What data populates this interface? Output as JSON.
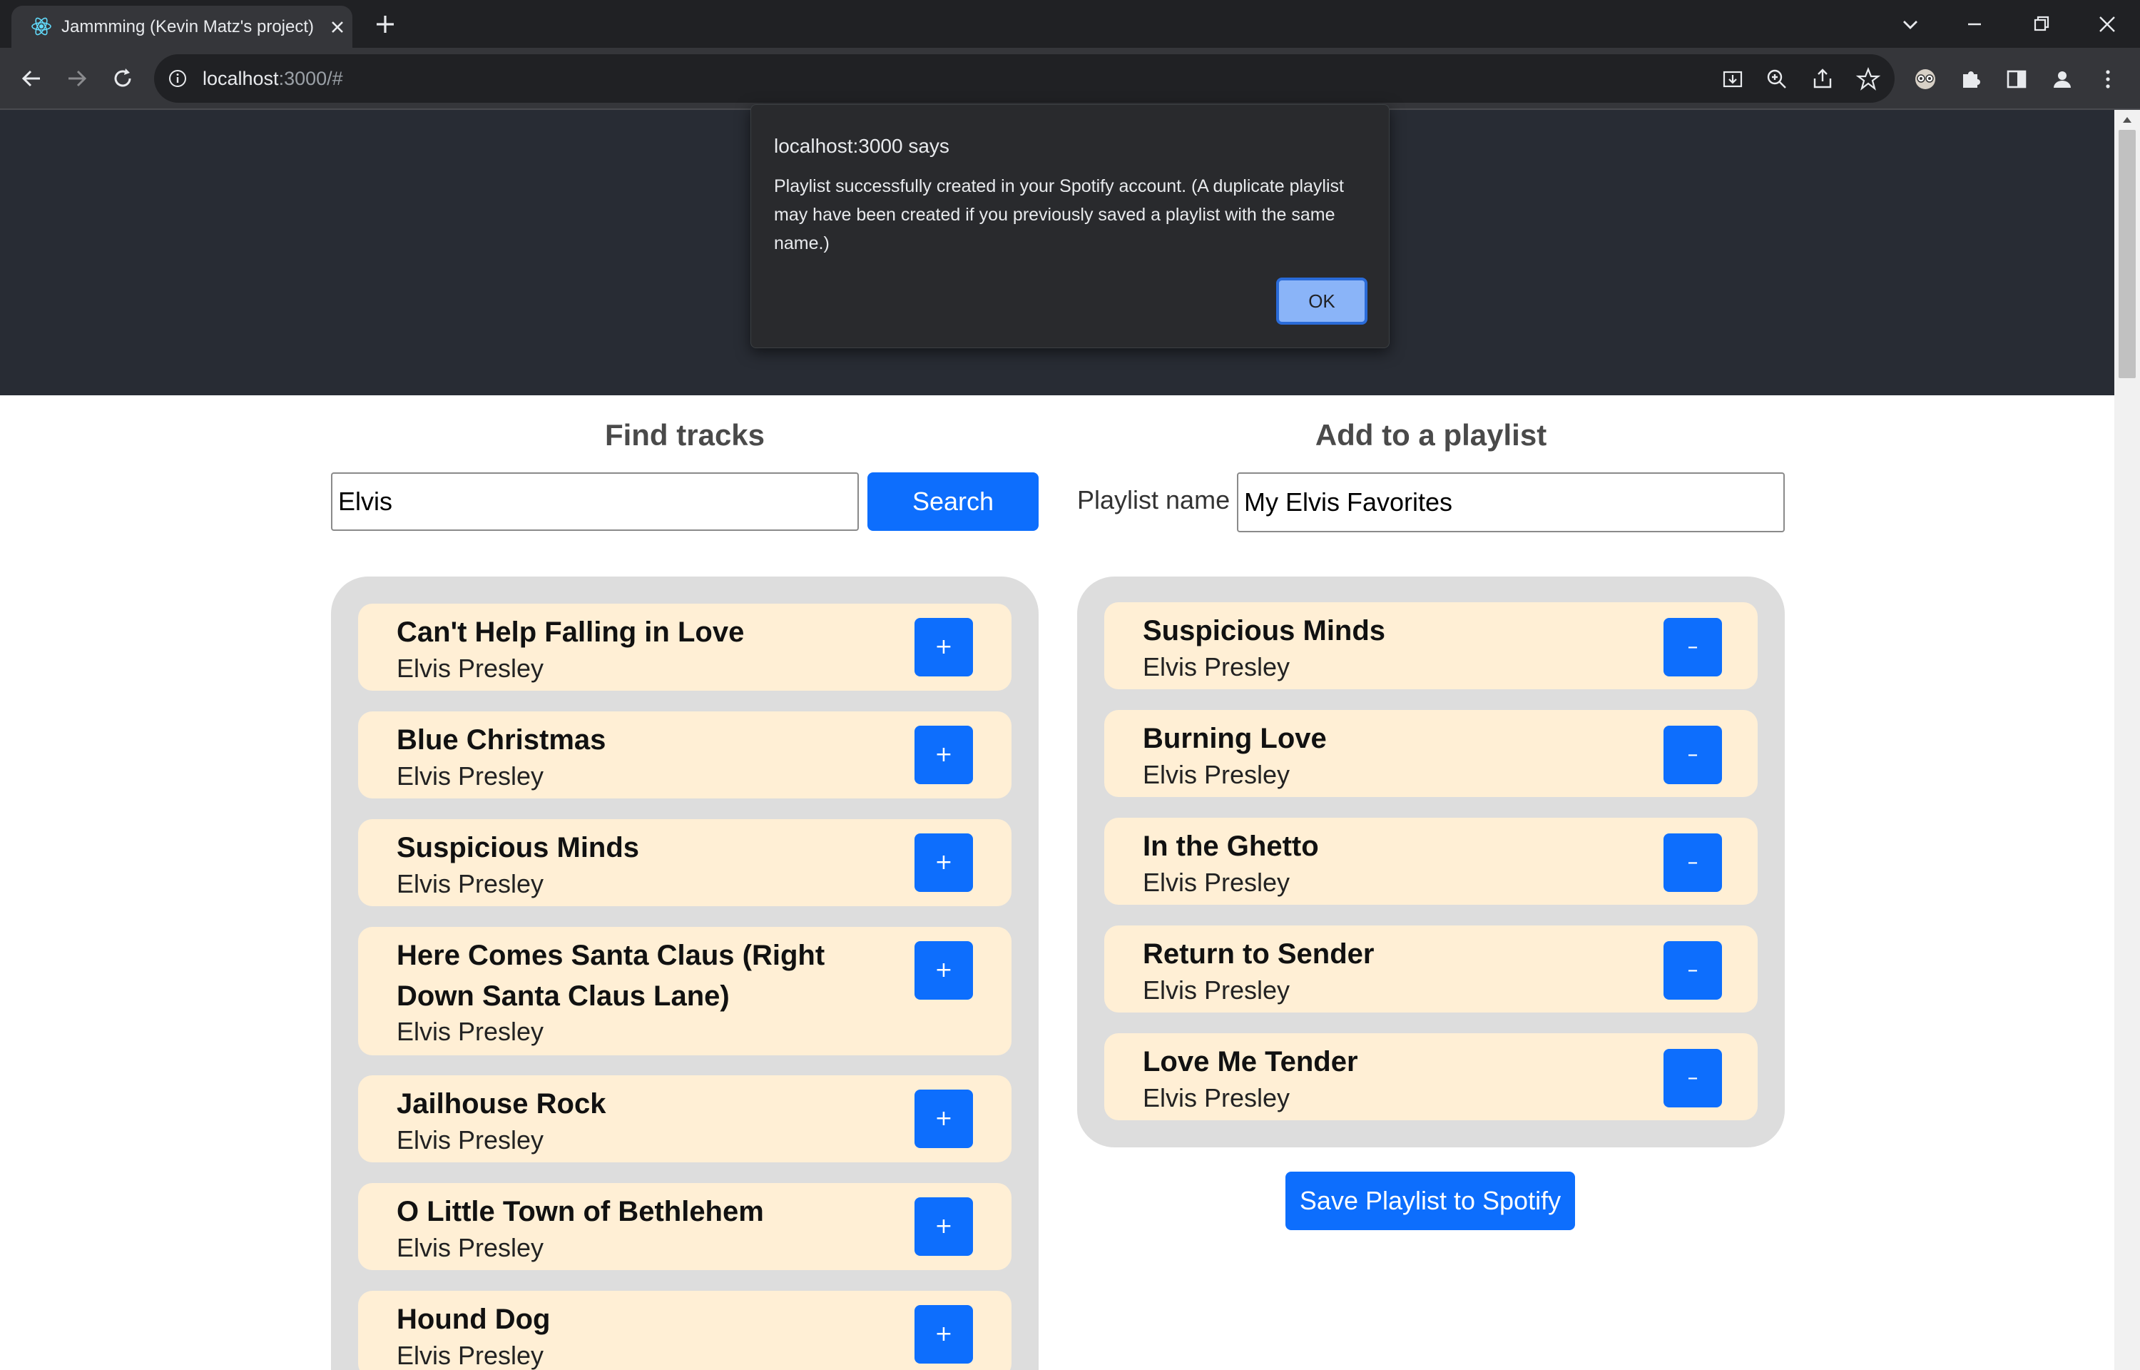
{
  "browser": {
    "tab_title": "Jammming (Kevin Matz's project)",
    "url_host": "localhost",
    "url_rest": ":3000/#"
  },
  "page": {
    "find_heading": "Find tracks",
    "search_value": "Elvis",
    "search_button": "Search",
    "playlist_heading": "Add to a playlist",
    "playlist_name_label": "Playlist name",
    "playlist_name_value": "My Elvis Favorites",
    "save_button": "Save Playlist to Spotify",
    "add_symbol": "+",
    "remove_symbol": "–"
  },
  "search_results": [
    {
      "title": "Can't Help Falling in Love",
      "artist": "Elvis Presley"
    },
    {
      "title": "Blue Christmas",
      "artist": "Elvis Presley"
    },
    {
      "title": "Suspicious Minds",
      "artist": "Elvis Presley"
    },
    {
      "title": "Here Comes Santa Claus (Right Down Santa Claus Lane)",
      "artist": "Elvis Presley"
    },
    {
      "title": "Jailhouse Rock",
      "artist": "Elvis Presley"
    },
    {
      "title": "O Little Town of Bethlehem",
      "artist": "Elvis Presley"
    },
    {
      "title": "Hound Dog",
      "artist": "Elvis Presley"
    }
  ],
  "playlist_tracks": [
    {
      "title": "Suspicious Minds",
      "artist": "Elvis Presley"
    },
    {
      "title": "Burning Love",
      "artist": "Elvis Presley"
    },
    {
      "title": "In the Ghetto",
      "artist": "Elvis Presley"
    },
    {
      "title": "Return to Sender",
      "artist": "Elvis Presley"
    },
    {
      "title": "Love Me Tender",
      "artist": "Elvis Presley"
    }
  ],
  "dialog": {
    "title": "localhost:3000 says",
    "message": "Playlist successfully created in your Spotify account. (A duplicate playlist may have been created if you previously saved a playlist with the same name.)",
    "ok": "OK"
  }
}
